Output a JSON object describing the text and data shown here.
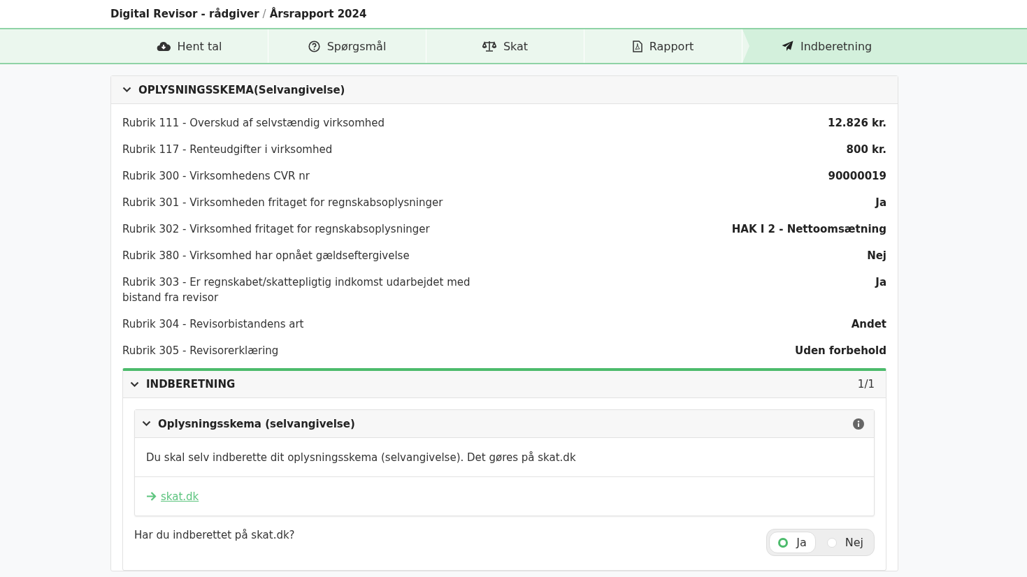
{
  "breadcrumb": {
    "app": "Digital Revisor - rådgiver",
    "separator": "/",
    "page": "Årsrapport 2024"
  },
  "steps": [
    {
      "label": "Hent tal",
      "selected": false
    },
    {
      "label": "Spørgsmål",
      "selected": false
    },
    {
      "label": "Skat",
      "selected": false
    },
    {
      "label": "Rapport",
      "selected": false
    },
    {
      "label": "Indberetning",
      "selected": true
    }
  ],
  "form_section": {
    "title": "OPLYSNINGSSKEMA(Selvangivelse)",
    "expanded": true,
    "rows": [
      {
        "label": "Rubrik 111 - Overskud af selvstændig virksomhed",
        "value": "12.826 kr."
      },
      {
        "label": "Rubrik 117 - Renteudgifter i virksomhed",
        "value": "800 kr."
      },
      {
        "label": "Rubrik 300 - Virksomhedens CVR nr",
        "value": "90000019"
      },
      {
        "label": "Rubrik 301 - Virksomheden fritaget for regnskabsoplysninger",
        "value": "Ja"
      },
      {
        "label": "Rubrik 302 - Virksomhed fritaget for regnskabsoplysninger",
        "value": "HAK I 2 - Nettoomsætning"
      },
      {
        "label": "Rubrik 380 - Virksomhed har opnået gældseftergivelse",
        "value": "Nej"
      },
      {
        "label": "Rubrik 303 - Er regnskabet/skattepligtig indkomst udarbejdet med bistand fra revisor",
        "value": "Ja"
      },
      {
        "label": "Rubrik 304 - Revisorbistandens art",
        "value": "Andet"
      },
      {
        "label": "Rubrik 305 - Revisorerklæring",
        "value": "Uden forbehold"
      }
    ]
  },
  "report_section": {
    "title": "INDBERETNING",
    "count": "1/1",
    "expanded": true,
    "item": {
      "title": "Oplysningsskema (selvangivelse)",
      "expanded": true,
      "text": "Du skal selv indberette dit oplysningsskema (selvangivelse). Det gøres på skat.dk",
      "link": "skat.dk"
    },
    "question": "Har du indberettet på skat.dk?",
    "options": [
      {
        "label": "Ja",
        "selected": true
      },
      {
        "label": "Nej",
        "selected": false
      }
    ]
  }
}
